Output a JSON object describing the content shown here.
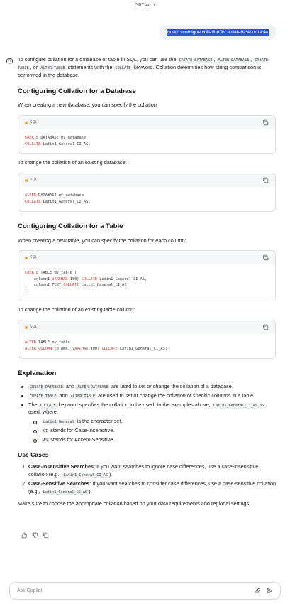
{
  "header": {
    "model_name": "GPT 4o",
    "chevron": "▾"
  },
  "user_message": "how to configue collation for a database or table",
  "answer": {
    "intro": {
      "t1": "To configure collation for a database or table in SQL, you can use the ",
      "c1": "CREATE DATABASE",
      "t2": ", ",
      "c2": "ALTER DATABASE",
      "t3": ", ",
      "c3": "CREATE TABLE",
      "t4": ", or ",
      "c4": "ALTER TABLE",
      "t5": " statements with the ",
      "c5": "COLLATE",
      "t6": " keyword. Collation determines how string comparison is performed in the database."
    },
    "sec1": {
      "heading": "Configuring Collation for a Database",
      "p1": "When creating a new database, you can specify the collation:",
      "code1": {
        "lang": "SQL",
        "l1_kw": "CREATE",
        "l1_rest": " DATABASE my_database",
        "l2_kw": "COLLATE",
        "l2_rest": " Latin1_General_CI_AS;"
      },
      "p2": "To change the collation of an existing database:",
      "code2": {
        "lang": "SQL",
        "l1_kw": "ALTER",
        "l1_rest": " DATABASE my_database",
        "l2_kw": "COLLATE",
        "l2_rest": " Latin1_General_CI_AS;"
      }
    },
    "sec2": {
      "heading": "Configuring Collation for a Table",
      "p1": "When creating a new table, you can specify the collation for each column:",
      "code1": {
        "lang": "SQL",
        "l1_kw": "CREATE",
        "l1_rest": " TABLE my_table (",
        "l2_a": "    column1 ",
        "l2_kw1": "VARCHAR",
        "l2_b": "(100) ",
        "l2_kw2": "COLLATE",
        "l2_c": " Latin1_General_CI_AS,",
        "l3_a": "    column2 TEXT ",
        "l3_kw": "COLLATE",
        "l3_b": " Latin1_General_CI_AS",
        "l4": ");"
      },
      "p2": "To change the collation of an existing table column:",
      "code2": {
        "lang": "SQL",
        "l1_kw": "ALTER",
        "l1_rest": " TABLE my_table",
        "l2_kw1": "ALTER",
        "l2_a": " ",
        "l2_kw2": "COLUMN",
        "l2_b": " column1 ",
        "l2_kw3": "VARCHAR",
        "l2_c": "(100) ",
        "l2_kw4": "COLLATE",
        "l2_d": " Latin1_General_CI_AS;"
      }
    },
    "explanation": {
      "heading": "Explanation",
      "b1": {
        "c1": "CREATE DATABASE",
        "t1": " and ",
        "c2": "ALTER DATABASE",
        "t2": " are used to set or change the collation of a database."
      },
      "b2": {
        "c1": "CREATE TABLE",
        "t1": " and ",
        "c2": "ALTER TABLE",
        "t2": " are used to set or change the collation of specific columns in a table."
      },
      "b3": {
        "t1": "The ",
        "c1": "COLLATE",
        "t2": " keyword specifies the collation to be used. In the examples above, ",
        "c2": "Latin1_General_CI_AS",
        "t3": " is used, where:"
      },
      "sub": [
        {
          "code": "Latin1_General",
          "text": " is the character set."
        },
        {
          "code": "CI",
          "text": " stands for Case-Insensitive."
        },
        {
          "code": "AS",
          "text": " stands for Accent-Sensitive."
        }
      ]
    },
    "usecases": {
      "heading": "Use Cases",
      "items": [
        {
          "num": "1.",
          "bold": "Case-Insensitive Searches",
          "t1": ": If you want searches to ignore case differences, use a case-insensitive collation (e.g., ",
          "code": "Latin1_General_CI_AS",
          "t2": ")."
        },
        {
          "num": "2.",
          "bold": "Case-Sensitive Searches",
          "t1": ": If you want searches to consider case differences, use a case-sensitive collation (e.g., ",
          "code": "Latin1_General_CS_AS",
          "t2": ")."
        }
      ]
    },
    "closing": "Make sure to choose the appropriate collation based on your data requirements and regional settings."
  },
  "composer": {
    "placeholder": "Ask Copilot"
  },
  "colors": {
    "highlight": "#2b55d4",
    "keyword": "#c0392b",
    "lang_dot": "#e5a23c"
  }
}
